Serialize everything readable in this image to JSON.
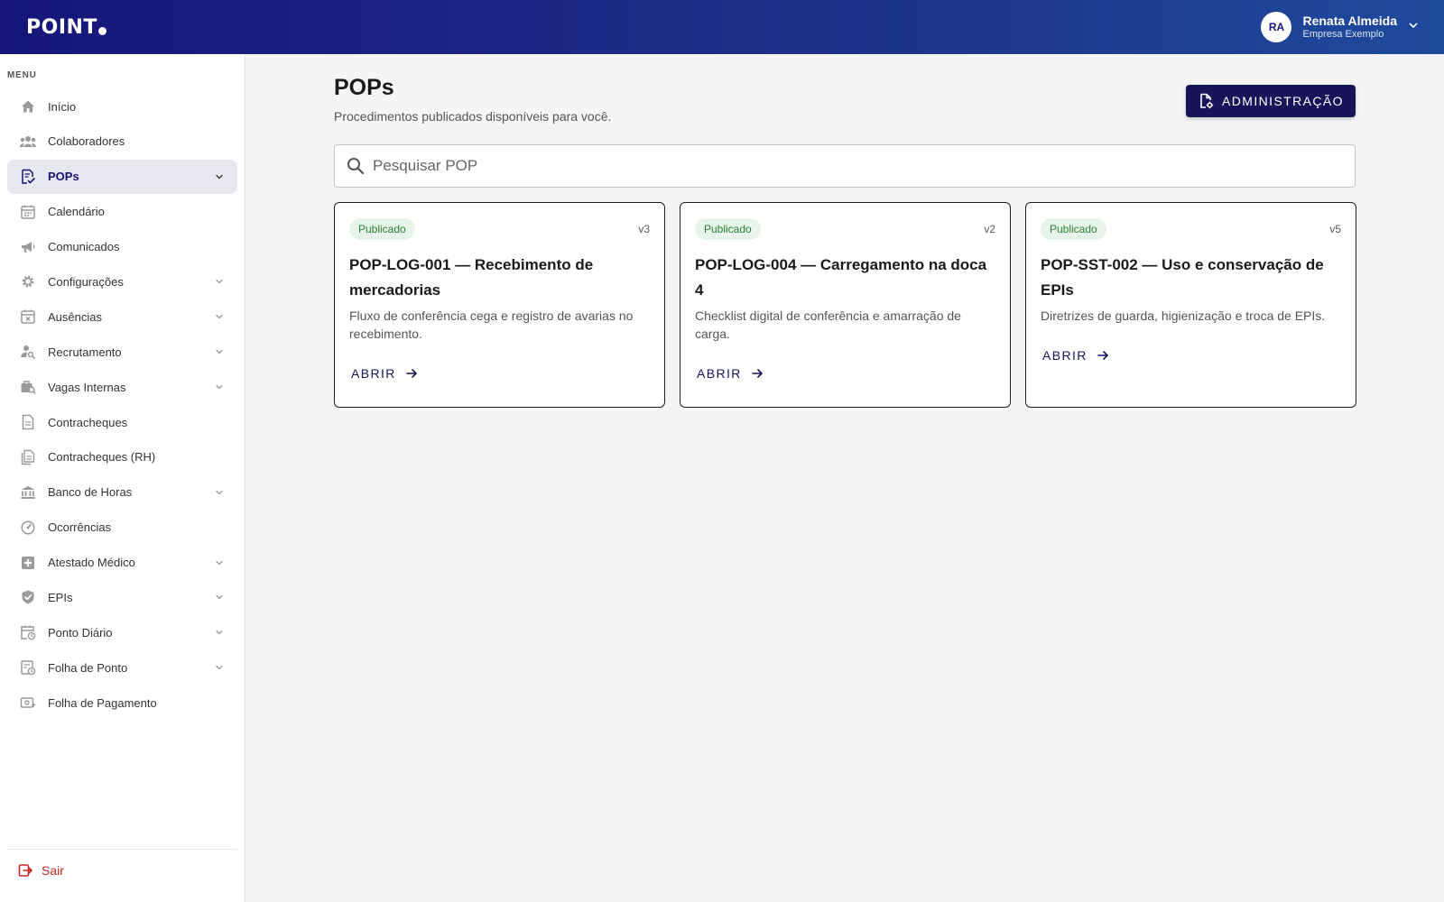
{
  "header": {
    "logo": "POINT",
    "user": {
      "initials": "RA",
      "name": "Renata Almeida",
      "company": "Empresa Exemplo"
    }
  },
  "sidebar": {
    "menu_label": "MENU",
    "items": [
      {
        "label": "Início",
        "icon": "home-icon",
        "expandable": false,
        "active": false
      },
      {
        "label": "Colaboradores",
        "icon": "people-icon",
        "expandable": false,
        "active": false
      },
      {
        "label": "POPs",
        "icon": "document-check-icon",
        "expandable": true,
        "active": true
      },
      {
        "label": "Calendário",
        "icon": "calendar-icon",
        "expandable": false,
        "active": false
      },
      {
        "label": "Comunicados",
        "icon": "megaphone-icon",
        "expandable": false,
        "active": false
      },
      {
        "label": "Configurações",
        "icon": "gear-icon",
        "expandable": true,
        "active": false
      },
      {
        "label": "Ausências",
        "icon": "calendar-x-icon",
        "expandable": true,
        "active": false
      },
      {
        "label": "Recrutamento",
        "icon": "person-search-icon",
        "expandable": true,
        "active": false
      },
      {
        "label": "Vagas Internas",
        "icon": "briefcase-search-icon",
        "expandable": true,
        "active": false
      },
      {
        "label": "Contracheques",
        "icon": "file-icon",
        "expandable": false,
        "active": false
      },
      {
        "label": "Contracheques (RH)",
        "icon": "files-icon",
        "expandable": false,
        "active": false
      },
      {
        "label": "Banco de Horas",
        "icon": "bank-icon",
        "expandable": true,
        "active": false
      },
      {
        "label": "Ocorrências",
        "icon": "gauge-icon",
        "expandable": false,
        "active": false
      },
      {
        "label": "Atestado Médico",
        "icon": "medical-plus-icon",
        "expandable": true,
        "active": false
      },
      {
        "label": "EPIs",
        "icon": "shield-check-icon",
        "expandable": true,
        "active": false
      },
      {
        "label": "Ponto Diário",
        "icon": "calendar-clock-icon",
        "expandable": true,
        "active": false
      },
      {
        "label": "Folha de Ponto",
        "icon": "timesheet-icon",
        "expandable": true,
        "active": false
      },
      {
        "label": "Folha de Pagamento",
        "icon": "payment-icon",
        "expandable": false,
        "active": false
      }
    ],
    "logout_label": "Sair"
  },
  "main": {
    "title": "POPs",
    "subtitle": "Procedimentos publicados disponíveis para você.",
    "admin_button": "ADMINISTRAÇÃO",
    "search": {
      "placeholder": "Pesquisar POP",
      "value": ""
    },
    "cards": [
      {
        "status": "Publicado",
        "version": "v3",
        "title": "POP-LOG-001 — Recebimento de mercadorias",
        "description": "Fluxo de conferência cega e registro de avarias no recebimento.",
        "action": "ABRIR"
      },
      {
        "status": "Publicado",
        "version": "v2",
        "title": "POP-LOG-004 — Carregamento na doca 4",
        "description": "Checklist digital de conferência e amarração de carga.",
        "action": "ABRIR"
      },
      {
        "status": "Publicado",
        "version": "v5",
        "title": "POP-SST-002 — Uso e conservação de EPIs",
        "description": "Diretrizes de guarda, higienização e troca de EPIs.",
        "action": "ABRIR"
      }
    ]
  },
  "colors": {
    "header_start": "#15157a",
    "header_end": "#1e4a9c",
    "primary": "#15155a",
    "badge_bg": "#e6f4ea",
    "badge_text": "#2e7d32",
    "logout": "#c62828"
  }
}
